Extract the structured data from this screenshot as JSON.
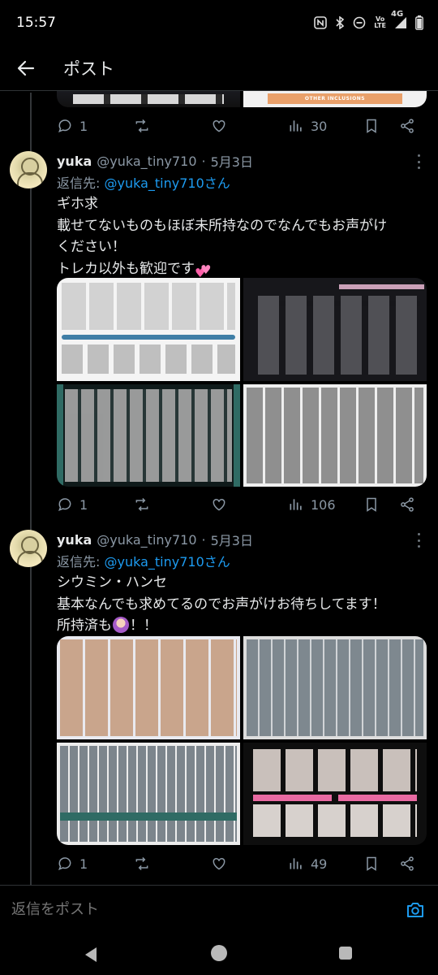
{
  "status_bar": {
    "time": "15:57",
    "icons": [
      "nfc-icon",
      "bluetooth-icon",
      "dnd-icon",
      "volte-icon",
      "signal-icon",
      "battery-icon"
    ],
    "network_label": "4G",
    "lte_label_top": "Vo",
    "lte_label_bottom": "LTE"
  },
  "header": {
    "back_icon": "arrow-left-icon",
    "title": "ポスト"
  },
  "top_tweet_actions": {
    "replies": "1",
    "retweets": "",
    "likes": "",
    "views": "30"
  },
  "partial_media": {
    "banner_text": "OTHER INCLUSIONS"
  },
  "tweets": [
    {
      "name": "yuka",
      "handle": "@yuka_tiny710",
      "separator": "·",
      "date": "5月3日",
      "reply_prefix": "返信先: ",
      "reply_mention": "@yuka_tiny710さん",
      "text_lines": [
        "ギホ求",
        "載せてないものもほぼ未所持なのでなんでもお声がけ",
        "ください！",
        "トレカ以外も歓迎です"
      ],
      "actions": {
        "replies": "1",
        "retweets": "",
        "likes": "",
        "views": "106"
      }
    },
    {
      "name": "yuka",
      "handle": "@yuka_tiny710",
      "separator": "·",
      "date": "5月3日",
      "reply_prefix": "返信先: ",
      "reply_mention": "@yuka_tiny710さん",
      "text_lines": [
        "シウミン・ハンセ",
        "基本なんでも求めてるのでお声がけお待ちしてます！",
        "所持済も",
        "！！"
      ],
      "actions": {
        "replies": "1",
        "retweets": "",
        "likes": "",
        "views": "49"
      }
    }
  ],
  "reply_bar": {
    "placeholder": "返信をポスト",
    "camera_icon": "camera-icon"
  },
  "colors": {
    "background": "#000000",
    "text": "#e7e9ea",
    "muted": "#8b98a5",
    "accent": "#1d9bf0",
    "divider": "#2f3336"
  }
}
